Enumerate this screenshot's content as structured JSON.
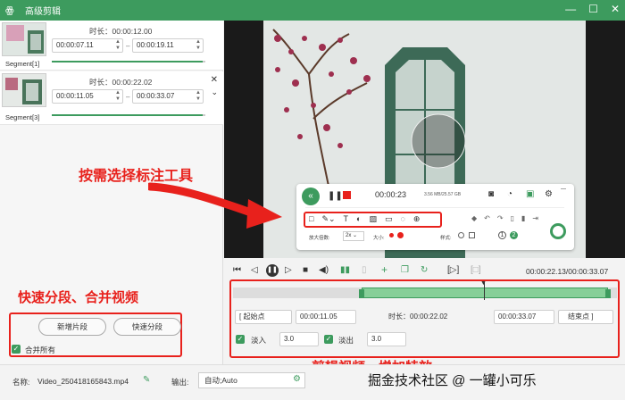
{
  "window": {
    "title": "高级剪辑"
  },
  "segments": [
    {
      "label": "Segment[1]",
      "duration": "时长：00:00:12.00",
      "start": "00:00:07.11",
      "end": "00:00:19.11",
      "progress": 0.98
    },
    {
      "label": "Segment[3]",
      "duration": "时长：00:00:22.02",
      "start": "00:00:11.05",
      "end": "00:00:33.07",
      "progress": 0.98
    }
  ],
  "left_panel": {
    "annotation": "快速分段、合并视频",
    "add_segment_label": "新增片段",
    "quick_split_label": "快速分段",
    "merge_all_label": "合并所有"
  },
  "annotations": {
    "select_tool": "按需选择标注工具",
    "edit_video": "剪辑视频、增加特效"
  },
  "recorder": {
    "time": "00:00:23",
    "size": "3.56 MB/25.57 GB",
    "zoom_label": "放大倍数:",
    "zoom_value": "2x",
    "size_label": "大小:",
    "style_label": "样式:",
    "mode_a": "1",
    "mode_b": "2"
  },
  "player": {
    "time": "00:00:22.13/00:00:33.07"
  },
  "clip": {
    "start_btn": "起始点",
    "start_value": "00:00:11.05",
    "duration": "时长：00:00:22.02",
    "end_value": "00:00:33.07",
    "end_btn": "结束点",
    "fade_in_label": "淡入",
    "fade_in_value": "3.0",
    "fade_out_label": "淡出",
    "fade_out_value": "3.0"
  },
  "bottom": {
    "name_label": "名称:",
    "name_value": "Video_250418165843.mp4",
    "output_label": "输出:",
    "output_value": "自动;Auto",
    "watermark": "掘金技术社区 @ 一罐小可乐"
  },
  "colors": {
    "accent": "#3d9b5e",
    "annotation": "#e8211c"
  }
}
